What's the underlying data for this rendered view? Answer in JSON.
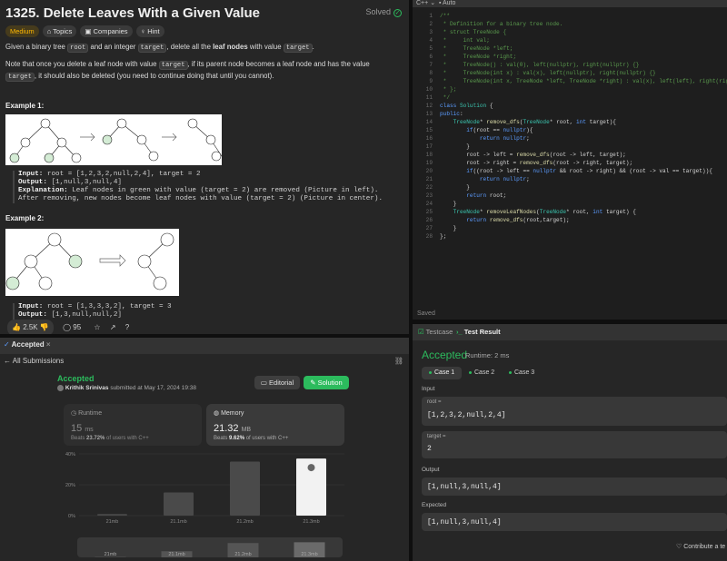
{
  "problem": {
    "title": "1325. Delete Leaves With a Given Value",
    "solved_label": "Solved",
    "chips": {
      "difficulty": "Medium",
      "topics": "Topics",
      "companies": "Companies",
      "hint": "Hint"
    },
    "desc1_a": "Given a binary tree",
    "desc1_root": "root",
    "desc1_b": "and an integer",
    "desc1_target": "target",
    "desc1_c": ", delete all the",
    "desc1_bold": "leaf nodes",
    "desc1_d": "with value",
    "desc1_e": ".",
    "desc2_a": "Note that once you delete a leaf node with value",
    "desc2_b": ", if its parent node becomes a leaf node and has the value",
    "desc2_c": ", it should also be deleted (you need to continue doing that until you cannot).",
    "ex1": {
      "heading": "Example 1:",
      "input_label": "Input:",
      "input": "root = [1,2,3,2,null,2,4], target = 2",
      "output_label": "Output:",
      "output": "[1,null,3,null,4]",
      "expl_label": "Explanation:",
      "expl": "Leaf nodes in green with value (target = 2) are removed (Picture in left).",
      "expl2": "After removing, new nodes become leaf nodes with value (target = 2) (Picture in center)."
    },
    "ex2": {
      "heading": "Example 2:",
      "input_label": "Input:",
      "input": "root = [1,3,3,3,2], target = 3",
      "output_label": "Output:",
      "output": "[1,3,null,null,2]"
    },
    "likes": "2.5K",
    "comments": "95"
  },
  "editor": {
    "lang": "C++",
    "mode": "Auto",
    "saved": "Saved",
    "lines": [
      [
        [
          "cm",
          "/**"
        ]
      ],
      [
        [
          "cm",
          " * Definition for a binary tree node."
        ]
      ],
      [
        [
          "cm",
          " * struct TreeNode {"
        ]
      ],
      [
        [
          "cm",
          " *     int val;"
        ]
      ],
      [
        [
          "cm",
          " *     TreeNode *left;"
        ]
      ],
      [
        [
          "cm",
          " *     TreeNode *right;"
        ]
      ],
      [
        [
          "cm",
          " *     TreeNode() : val(0), left(nullptr), right(nullptr) {}"
        ]
      ],
      [
        [
          "cm",
          " *     TreeNode(int x) : val(x), left(nullptr), right(nullptr) {}"
        ]
      ],
      [
        [
          "cm",
          " *     TreeNode(int x, TreeNode *left, TreeNode *right) : val(x), left(left), right(right) {}"
        ]
      ],
      [
        [
          "cm",
          " * };"
        ]
      ],
      [
        [
          "cm",
          " */"
        ]
      ],
      [
        [
          "kw",
          "class "
        ],
        [
          "ty",
          "Solution"
        ],
        [
          "tx",
          " {"
        ]
      ],
      [
        [
          "kw",
          "public"
        ],
        [
          "tx",
          ":"
        ]
      ],
      [
        [
          "tx",
          "    "
        ],
        [
          "ty",
          "TreeNode"
        ],
        [
          "tx",
          "* "
        ],
        [
          "fn",
          "remove_dfs"
        ],
        [
          "tx",
          "("
        ],
        [
          "ty",
          "TreeNode"
        ],
        [
          "tx",
          "* root, "
        ],
        [
          "kw",
          "int"
        ],
        [
          "tx",
          " target){"
        ]
      ],
      [
        [
          "tx",
          "        "
        ],
        [
          "kw",
          "if"
        ],
        [
          "tx",
          "(root == "
        ],
        [
          "kw",
          "nullptr"
        ],
        [
          "tx",
          "){"
        ]
      ],
      [
        [
          "tx",
          "            "
        ],
        [
          "kw",
          "return"
        ],
        [
          "tx",
          " "
        ],
        [
          "kw",
          "nullptr"
        ],
        [
          "tx",
          ";"
        ]
      ],
      [
        [
          "tx",
          "        }"
        ]
      ],
      [
        [
          "tx",
          "        root -> left = "
        ],
        [
          "fn",
          "remove_dfs"
        ],
        [
          "tx",
          "(root -> left, target);"
        ]
      ],
      [
        [
          "tx",
          "        root -> right = "
        ],
        [
          "fn",
          "remove_dfs"
        ],
        [
          "tx",
          "(root -> right, target);"
        ]
      ],
      [
        [
          "tx",
          "        "
        ],
        [
          "kw",
          "if"
        ],
        [
          "tx",
          "((root -> left == "
        ],
        [
          "kw",
          "nullptr"
        ],
        [
          "tx",
          " && root -> right) && (root -> val == target)){"
        ]
      ],
      [
        [
          "tx",
          "            "
        ],
        [
          "kw",
          "return"
        ],
        [
          "tx",
          " "
        ],
        [
          "kw",
          "nullptr"
        ],
        [
          "tx",
          ";"
        ]
      ],
      [
        [
          "tx",
          "        }"
        ]
      ],
      [
        [
          "tx",
          "        "
        ],
        [
          "kw",
          "return"
        ],
        [
          "tx",
          " root;"
        ]
      ],
      [
        [
          "tx",
          "    }"
        ]
      ],
      [
        [
          "tx",
          "    "
        ],
        [
          "ty",
          "TreeNode"
        ],
        [
          "tx",
          "* "
        ],
        [
          "fn",
          "removeLeafNodes"
        ],
        [
          "tx",
          "("
        ],
        [
          "ty",
          "TreeNode"
        ],
        [
          "tx",
          "* root, "
        ],
        [
          "kw",
          "int"
        ],
        [
          "tx",
          " target) {"
        ]
      ],
      [
        [
          "tx",
          "        "
        ],
        [
          "kw",
          "return"
        ],
        [
          "tx",
          " "
        ],
        [
          "fn",
          "remove_dfs"
        ],
        [
          "tx",
          "(root,target);"
        ]
      ],
      [
        [
          "tx",
          "    }"
        ]
      ],
      [
        [
          "tx",
          "};"
        ]
      ]
    ]
  },
  "submission": {
    "tab": "Accepted",
    "back": "All Submissions",
    "status": "Accepted",
    "author": "Krithik Srinivas",
    "submitted": "submitted at May 17, 2024 19:38",
    "editorial": "Editorial",
    "solution": "Solution",
    "runtime_label": "Runtime",
    "runtime_value": "15",
    "runtime_unit": "ms",
    "runtime_beats_a": "Beats",
    "runtime_beats_pct": "23.72%",
    "runtime_beats_b": "of users with C++",
    "memory_label": "Memory",
    "memory_value": "21.32",
    "memory_unit": "MB",
    "memory_beats_a": "Beats",
    "memory_beats_pct": "9.62%",
    "memory_beats_b": "of users with C++"
  },
  "chart_data": {
    "type": "bar",
    "categories": [
      "21mb",
      "21.1mb",
      "21.2mb",
      "21.3mb"
    ],
    "values": [
      1,
      15,
      35,
      37
    ],
    "yticks": [
      "40%",
      "20%",
      "0%"
    ],
    "ylim": [
      0,
      40
    ],
    "highlight_index": 3,
    "bar_colors": [
      "#4a4a4a",
      "#4a4a4a",
      "#4a4a4a",
      "#f2f2f2"
    ]
  },
  "testresult": {
    "tab1": "Testcase",
    "tab2": "Test Result",
    "status": "Accepted",
    "runtime": "Runtime: 2 ms",
    "cases": [
      "Case 1",
      "Case 2",
      "Case 3"
    ],
    "input_label": "Input",
    "var1": "root =",
    "val1": "[1,2,3,2,null,2,4]",
    "var2": "target =",
    "val2": "2",
    "output_label": "Output",
    "output": "[1,null,3,null,4]",
    "expected_label": "Expected",
    "expected": "[1,null,3,null,4]",
    "contribute": "Contribute a te"
  }
}
